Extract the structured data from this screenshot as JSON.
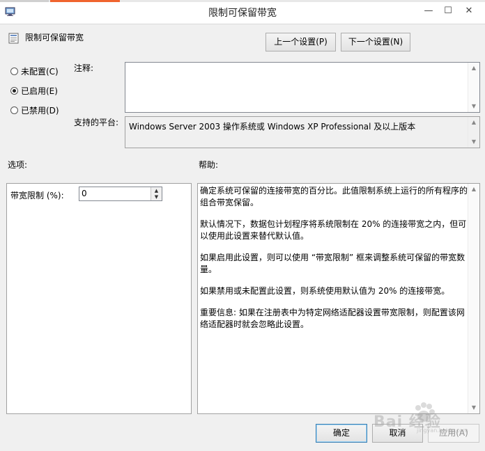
{
  "window": {
    "title": "限制可保留带宽",
    "minimize_glyph": "—",
    "maximize_glyph": "☐",
    "close_glyph": "✕"
  },
  "header": {
    "policy_name": "限制可保留带宽",
    "prev_button": "上一个设置(P)",
    "next_button": "下一个设置(N)"
  },
  "state": {
    "options": [
      {
        "label": "未配置(C)",
        "checked": false
      },
      {
        "label": "已启用(E)",
        "checked": true
      },
      {
        "label": "已禁用(D)",
        "checked": false
      }
    ]
  },
  "comment": {
    "label": "注释:",
    "value": ""
  },
  "platform": {
    "label": "支持的平台:",
    "value": "Windows Server 2003 操作系统或 Windows XP Professional 及以上版本"
  },
  "options_panel": {
    "heading": "选项:",
    "bandwidth_label": "带宽限制 (%):",
    "bandwidth_value": "0"
  },
  "help_panel": {
    "heading": "帮助:",
    "paragraphs": [
      "确定系统可保留的连接带宽的百分比。此值限制系统上运行的所有程序的组合带宽保留。",
      "默认情况下，数据包计划程序将系统限制在 20% 的连接带宽之内，但可以使用此设置来替代默认值。",
      "如果启用此设置，则可以使用 “带宽限制” 框来调整系统可保留的带宽数量。",
      "如果禁用或未配置此设置，则系统使用默认值为 20% 的连接带宽。",
      "重要信息: 如果在注册表中为特定网络适配器设置带宽限制，则配置该网络适配器时就会忽略此设置。"
    ]
  },
  "footer": {
    "ok": "确定",
    "cancel": "取消",
    "apply": "应用(A)"
  },
  "watermark": {
    "text": "Bai 经验",
    "sub": "jingyan.baidu.com"
  },
  "colors": {
    "accent_orange": "#f0642e",
    "accent_blue": "#3c7fb1"
  }
}
